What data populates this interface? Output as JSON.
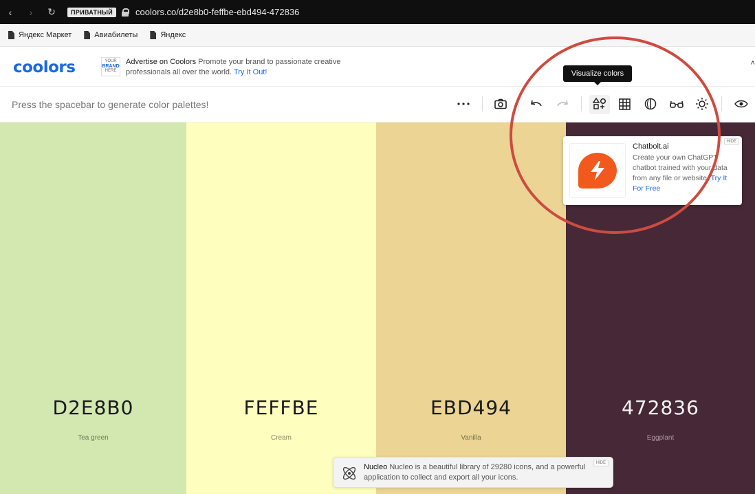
{
  "browser": {
    "back": "‹",
    "forward": "›",
    "reload": "↻",
    "private_label": "ПРИВАТНЫЙ",
    "url": "coolors.co/d2e8b0-feffbe-ebd494-472836"
  },
  "bookmarks": [
    "Яндекс Маркет",
    "Авиабилеты",
    "Яндекс"
  ],
  "ad": {
    "logo": "coolors",
    "brand_box": [
      "YOUR",
      "BRAND",
      "HERE"
    ],
    "title": "Advertise on Coolors",
    "text": "Promote your brand to passionate creative professionals all over the world.",
    "link": "Try It Out!",
    "caret": "˄"
  },
  "toolbar": {
    "hint": "Press the spacebar to generate color palettes!",
    "more_icon": "more-dots-icon",
    "tooltip": "Visualize colors",
    "icons": [
      "camera-icon",
      "undo-icon",
      "redo-icon",
      "visualize-shapes-icon",
      "grid-icon",
      "contrast-icon",
      "glasses-icon",
      "brightness-icon",
      "eye-icon"
    ]
  },
  "palette": [
    {
      "hex": "D2E8B0",
      "name": "Tea green",
      "color": "#d2e8b0",
      "text_color": "#1b1b1b"
    },
    {
      "hex": "FEFFBE",
      "name": "Cream",
      "color": "#feffbe",
      "text_color": "#1b1b1b"
    },
    {
      "hex": "EBD494",
      "name": "Vanilla",
      "color": "#ebd494",
      "text_color": "#1b1b1b"
    },
    {
      "hex": "472836",
      "name": "Eggplant",
      "color": "#472836",
      "text_color": "#f2f2f2"
    }
  ],
  "chatbot_ad": {
    "title": "Chatbolt.ai",
    "text": "Create your own ChatGPT chatbot trained with your data from any file or website.",
    "link": "Try It For Free",
    "hide": "HIDE"
  },
  "nucleo_toast": {
    "title": "Nucleo",
    "text": "Nucleo is a beautiful library of 29280 icons, and a powerful application to collect and export all your icons.",
    "hide": "HIDE"
  },
  "colors": {
    "accent": "#1868e8",
    "annotation": "#cd4b40",
    "chatbot_orange": "#f25a1d"
  }
}
